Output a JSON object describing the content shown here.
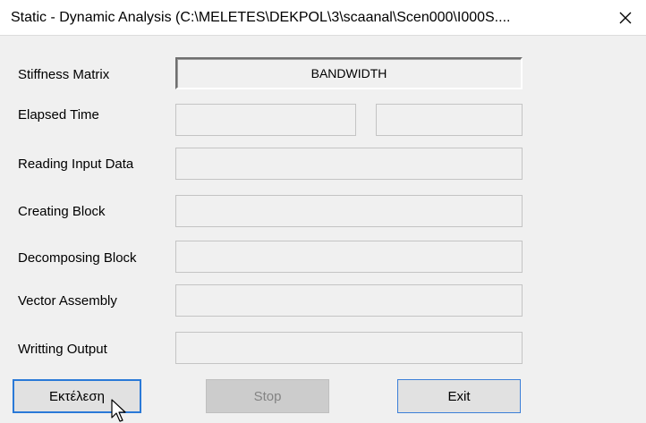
{
  "window": {
    "title": "Static - Dynamic Analysis (C:\\MELETES\\DEKPOL\\3\\scaanal\\Scen000\\I000S....",
    "close_icon": "close-icon"
  },
  "rows": [
    {
      "label": "Stiffness Matrix",
      "value": "BANDWIDTH"
    },
    {
      "label": "Elapsed Time",
      "value": ""
    },
    {
      "label": "Reading Input Data",
      "value": ""
    },
    {
      "label": "Creating Block",
      "value": ""
    },
    {
      "label": "Decomposing Block",
      "value": ""
    },
    {
      "label": "Vector Assembly",
      "value": ""
    },
    {
      "label": "Writting Output",
      "value": ""
    }
  ],
  "buttons": {
    "run_label": "Εκτέλεση",
    "stop_label": "Stop",
    "exit_label": "Exit"
  },
  "colors": {
    "focus_border": "#2a79d7",
    "background": "#f0f0f0"
  }
}
